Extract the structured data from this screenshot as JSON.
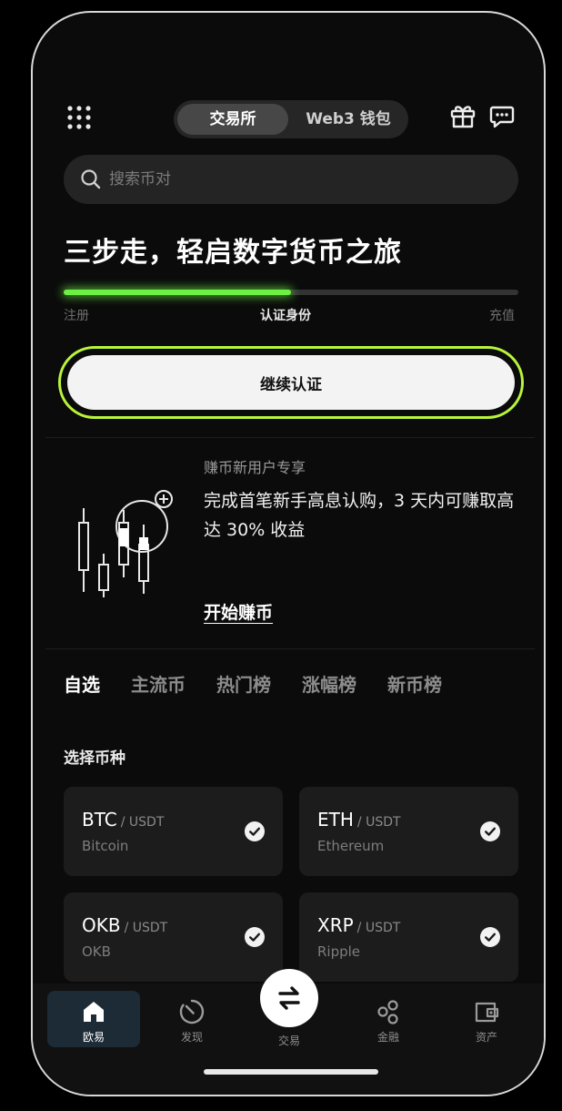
{
  "header": {
    "tabs": [
      {
        "label": "交易所",
        "active": true
      },
      {
        "label": "Web3 钱包",
        "active": false
      }
    ],
    "icons": [
      "grid-menu-icon",
      "gift-icon",
      "chat-icon"
    ]
  },
  "search": {
    "placeholder": "搜索币对"
  },
  "onboarding": {
    "headline": "三步走，轻启数字货币之旅",
    "progress": 0.5,
    "steps": [
      "注册",
      "认证身份",
      "充值"
    ],
    "current_step": 1,
    "continue_label": "继续认证",
    "accent_color": "#b9f43b"
  },
  "promo": {
    "subtitle": "赚币新用户专享",
    "text": "完成首笔新手高息认购，3 天内可赚取高达 30% 收益",
    "link_label": "开始赚币"
  },
  "market_tabs": [
    {
      "label": "自选",
      "active": true
    },
    {
      "label": "主流币",
      "active": false
    },
    {
      "label": "热门榜",
      "active": false
    },
    {
      "label": "涨幅榜",
      "active": false
    },
    {
      "label": "新币榜",
      "active": false
    }
  ],
  "coin_section": {
    "label": "选择币种",
    "coins": [
      {
        "symbol": "BTC",
        "quote": "/ USDT",
        "name": "Bitcoin",
        "selected": true
      },
      {
        "symbol": "ETH",
        "quote": "/ USDT",
        "name": "Ethereum",
        "selected": true
      },
      {
        "symbol": "OKB",
        "quote": "/ USDT",
        "name": "OKB",
        "selected": true
      },
      {
        "symbol": "XRP",
        "quote": "/ USDT",
        "name": "Ripple",
        "selected": true
      }
    ]
  },
  "bottom_nav": {
    "items": [
      {
        "label": "欧易",
        "icon": "home-icon",
        "active": true
      },
      {
        "label": "发现",
        "icon": "discover-icon",
        "active": false
      },
      {
        "label": "交易",
        "icon": "swap-icon",
        "active": false
      },
      {
        "label": "金融",
        "icon": "finance-icon",
        "active": false
      },
      {
        "label": "资产",
        "icon": "wallet-icon",
        "active": false
      }
    ]
  }
}
